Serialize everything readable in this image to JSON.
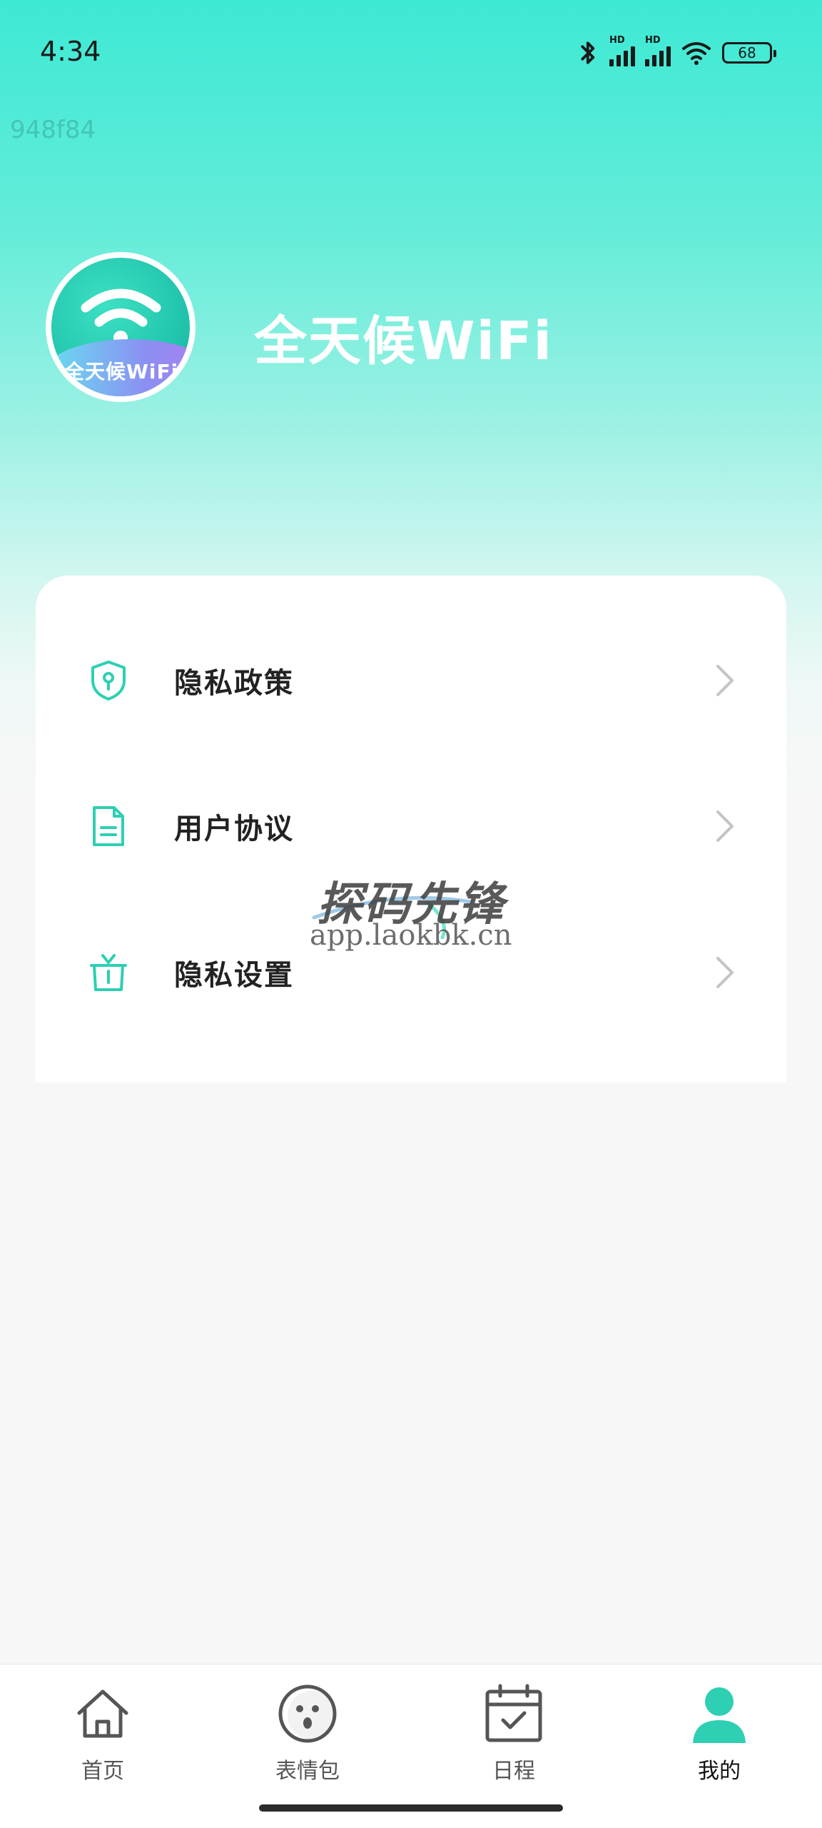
{
  "status_bar": {
    "time": "4:34",
    "hd_label": "HD",
    "battery": "68"
  },
  "build_id": "948f84",
  "app": {
    "name": "全天候WiFi",
    "logo_text": "全天候WiFi"
  },
  "menu": {
    "items": [
      {
        "label": "隐私政策",
        "icon": "shield-icon"
      },
      {
        "label": "用户协议",
        "icon": "document-icon"
      },
      {
        "label": "隐私设置",
        "icon": "gift-icon"
      }
    ]
  },
  "watermark": {
    "title": "探码先锋",
    "url": "app.laokbk.cn"
  },
  "bottom_nav": {
    "items": [
      {
        "label": "首页",
        "icon": "home-icon"
      },
      {
        "label": "表情包",
        "icon": "emoji-face-icon"
      },
      {
        "label": "日程",
        "icon": "calendar-icon"
      },
      {
        "label": "我的",
        "icon": "user-icon"
      }
    ],
    "active_index": 3
  },
  "colors": {
    "accent": "#2ecfb2",
    "header_top": "#3de9d4",
    "background": "#f7f7f7",
    "text_primary": "#222222",
    "chevron": "#c4c4c4"
  }
}
